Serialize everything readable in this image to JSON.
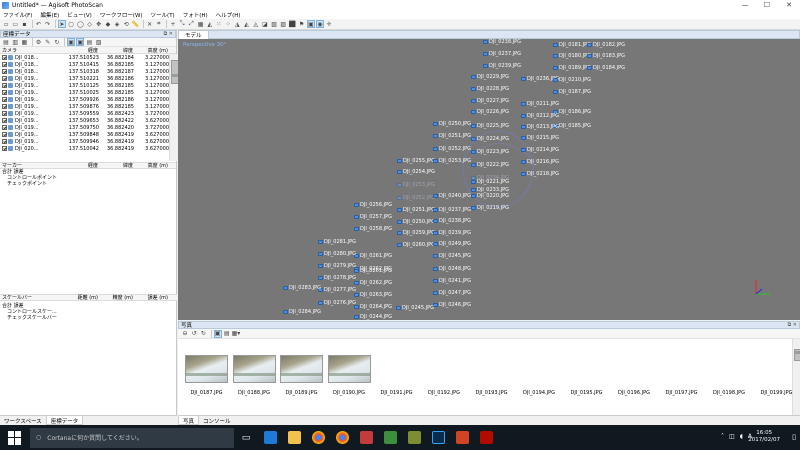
{
  "window": {
    "title": "Untitled* — Agisoft PhotoScan",
    "controls": [
      "—",
      "☐",
      "✕"
    ]
  },
  "menu": [
    "ファイル(F)",
    "編集(E)",
    "ビュー(V)",
    "ワークフロー(W)",
    "ツール(T)",
    "フォト(H)",
    "ヘルプ(H)"
  ],
  "reference_panel": {
    "title": "座標データ",
    "columns": [
      "カメラ",
      "経度",
      "緯度",
      "高度 (m)"
    ],
    "cameras": [
      {
        "name": "DJI_018...",
        "lon": "137.510523",
        "lat": "36.882184",
        "alt": "3.227000"
      },
      {
        "name": "DJI_018...",
        "lon": "137.510415",
        "lat": "36.882185",
        "alt": "3.127000"
      },
      {
        "name": "DJI_018...",
        "lon": "137.510318",
        "lat": "36.882187",
        "alt": "3.127000"
      },
      {
        "name": "DJI_019...",
        "lon": "137.510221",
        "lat": "36.882186",
        "alt": "3.127000"
      },
      {
        "name": "DJI_019...",
        "lon": "137.510125",
        "lat": "36.882185",
        "alt": "3.127000"
      },
      {
        "name": "DJI_019...",
        "lon": "137.510025",
        "lat": "36.882185",
        "alt": "3.127000"
      },
      {
        "name": "DJI_019...",
        "lon": "137.509926",
        "lat": "36.882186",
        "alt": "3.127000"
      },
      {
        "name": "DJI_019...",
        "lon": "137.509876",
        "lat": "36.882185",
        "alt": "3.127000"
      },
      {
        "name": "DJI_019...",
        "lon": "137.509559",
        "lat": "36.882423",
        "alt": "3.727000"
      },
      {
        "name": "DJI_019...",
        "lon": "137.509653",
        "lat": "36.882422",
        "alt": "3.627000"
      },
      {
        "name": "DJI_019...",
        "lon": "137.509750",
        "lat": "36.882420",
        "alt": "3.727000"
      },
      {
        "name": "DJI_019...",
        "lon": "137.509848",
        "lat": "36.882419",
        "alt": "3.627000"
      },
      {
        "name": "DJI_019...",
        "lon": "137.509946",
        "lat": "36.882419",
        "alt": "3.627000"
      },
      {
        "name": "DJI_020...",
        "lon": "137.510042",
        "lat": "36.882419",
        "alt": "3.627000"
      }
    ],
    "markers_columns": [
      "マーカー",
      "経度",
      "緯度",
      "高度 (m)"
    ],
    "markers_tree": {
      "root": "合計 誤差",
      "children": [
        "コントロールポイント",
        "チェックポイント"
      ]
    },
    "scalebars_columns": [
      "スケールバー",
      "距離 (m)",
      "精度 (m)",
      "誤差 (m)"
    ],
    "scalebars_tree": {
      "root": "合計 誤差",
      "children": [
        "コントロールスケー...",
        "チェックスケールバー"
      ]
    }
  },
  "left_tabs": [
    "ワークスペース",
    "座標データ"
  ],
  "model": {
    "tab": "モデル",
    "view_label": "Perspective 30°",
    "cameras": [
      {
        "label": "DJI_0238.JPG"
      },
      {
        "label": "DJI_0181.JPG"
      },
      {
        "label": "DJI_0182.JPG"
      },
      {
        "label": "DJI_0237.JPG"
      },
      {
        "label": "DJI_0180.JPG"
      },
      {
        "label": "DJI_0183.JPG"
      },
      {
        "label": "DJI_0239.JPG"
      },
      {
        "label": "DJI_0189.JPG"
      },
      {
        "label": "DJI_0184.JPG"
      },
      {
        "label": "DJI_0229.JPG"
      },
      {
        "label": "DJI_0236.JPG"
      },
      {
        "label": "DJI_0210.JPG"
      },
      {
        "label": "DJI_0228.JPG"
      },
      {
        "label": "DJI_0187.JPG"
      },
      {
        "label": "DJI_0227.JPG"
      },
      {
        "label": "DJI_0211.JPG"
      },
      {
        "label": "DJI_0186.JPG"
      },
      {
        "label": "DJI_0226.JPG"
      },
      {
        "label": "DJI_0212.JPG"
      },
      {
        "label": "DJI_0185.JPG"
      },
      {
        "label": "DJI_0250.JPG"
      },
      {
        "label": "DJI_0225.JPG"
      },
      {
        "label": "DJI_0213.JPG"
      },
      {
        "label": "DJI_0251.JPG"
      },
      {
        "label": "DJI_0224.JPG"
      },
      {
        "label": "DJI_0215.JPG"
      },
      {
        "label": "DJI_0252.JPG"
      },
      {
        "label": "DJI_0223.JPG"
      },
      {
        "label": "DJI_0214.JPG"
      },
      {
        "label": "DJI_0255.JPG"
      },
      {
        "label": "DJI_0253.JPG"
      },
      {
        "label": "DJI_0222.JPG"
      },
      {
        "label": "DJI_0216.JPG"
      },
      {
        "label": "DJI_0254.JPG"
      },
      {
        "label": "DJI_0234.JPG"
      },
      {
        "label": "DJI_0221.JPG"
      },
      {
        "label": "DJI_0218.JPG"
      },
      {
        "label": "DJI_0253.JPG"
      },
      {
        "label": "DJI_0233.JPG"
      },
      {
        "label": "DJI_0220.JPG"
      },
      {
        "label": "DJI_0252.JPG"
      },
      {
        "label": "DJI_0240.JPG"
      },
      {
        "label": "DJI_0219.JPG"
      },
      {
        "label": "DJI_0256.JPG"
      },
      {
        "label": "DJI_0251.JPG"
      },
      {
        "label": "DJI_0237.JPG"
      },
      {
        "label": "DJI_0257.JPG"
      },
      {
        "label": "DJI_0250.JPG"
      },
      {
        "label": "DJI_0238.JPG"
      },
      {
        "label": "DJI_0258.JPG"
      },
      {
        "label": "DJI_0259.JPG"
      },
      {
        "label": "DJI_0239.JPG"
      },
      {
        "label": "DJI_0260.JPG"
      },
      {
        "label": "DJI_0249.JPG"
      },
      {
        "label": "DJI_0281.JPG"
      },
      {
        "label": "DJI_0261.JPG"
      },
      {
        "label": "DJI_0245.JPG"
      },
      {
        "label": "DJI_0280.JPG"
      },
      {
        "label": "DJI_0262.JPG"
      },
      {
        "label": "DJI_0248.JPG"
      },
      {
        "label": "DJI_0279.JPG"
      },
      {
        "label": "DJI_0261.JPG"
      },
      {
        "label": "DJI_0241.JPG"
      },
      {
        "label": "DJI_0278.JPG"
      },
      {
        "label": "DJI_0262.JPG"
      },
      {
        "label": "DJI_0247.JPG"
      },
      {
        "label": "DJI_0277.JPG"
      },
      {
        "label": "DJI_0263.JPG"
      },
      {
        "label": "DJI_0246.JPG"
      },
      {
        "label": "DJI_0283.JPG"
      },
      {
        "label": "DJI_0276.JPG"
      },
      {
        "label": "DJI_0264.JPG"
      },
      {
        "label": "DJI_0245.JPG"
      },
      {
        "label": "DJI_0284.JPG"
      },
      {
        "label": "DJI_0244.JPG"
      }
    ]
  },
  "photos": {
    "title": "写真",
    "items": [
      "DJI_0187.JPG",
      "DJI_0188.JPG",
      "DJI_0189.JPG",
      "DJI_0190.JPG",
      "DJI_0191.JPG",
      "DJI_0192.JPG",
      "DJI_0193.JPG",
      "DJI_0194.JPG",
      "DJI_0195.JPG",
      "DJI_0196.JPG",
      "DJI_0197.JPG",
      "DJI_0198.JPG",
      "DJI_0199.JPG"
    ]
  },
  "right_tabs": [
    "写真",
    "コンソール"
  ],
  "taskbar": {
    "search_placeholder": "Cortanaに何か質問してください。",
    "time": "16:05",
    "date": "2017/02/07"
  }
}
